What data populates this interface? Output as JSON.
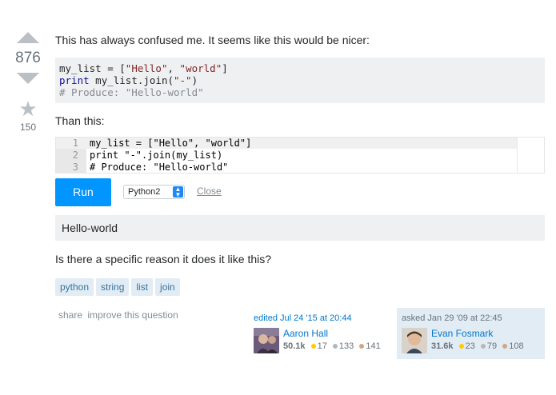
{
  "vote": {
    "score": "876",
    "favorites": "150"
  },
  "post": {
    "intro": "This has always confused me. It seems like this would be nicer:",
    "code_block": {
      "line1_a": "my_list = [",
      "line1_s1": "\"Hello\"",
      "line1_b": ", ",
      "line1_s2": "\"world\"",
      "line1_c": "]",
      "line2_kw": "print",
      "line2_a": " my_list.join(",
      "line2_s": "\"-\"",
      "line2_b": ")",
      "line3": "# Produce: \"Hello-world\""
    },
    "than": "Than this:",
    "editor_lines": [
      {
        "num": "1",
        "code": "my_list = [\"Hello\", \"world\"]"
      },
      {
        "num": "2",
        "code": "print \"-\".join(my_list)"
      },
      {
        "num": "3",
        "code": "# Produce: \"Hello-world\""
      }
    ],
    "run_label": "Run",
    "language": "Python2",
    "close_label": "Close",
    "result": "Hello-world",
    "question": "Is there a specific reason it does it like this?",
    "tags": [
      "python",
      "string",
      "list",
      "join"
    ]
  },
  "actions": {
    "share": "share",
    "improve": "improve this question"
  },
  "edited": {
    "when": "edited Jul 24 '15 at 20:44",
    "user": "Aaron Hall",
    "rep": "50.1k",
    "gold": "17",
    "silver": "133",
    "bronze": "141"
  },
  "asked": {
    "when": "asked Jan 29 '09 at 22:45",
    "user": "Evan Fosmark",
    "rep": "31.6k",
    "gold": "23",
    "silver": "79",
    "bronze": "108"
  },
  "colors": {
    "accent": "#0095ff",
    "link": "#0077cc",
    "tag_bg": "#e1ecf4",
    "tag_fg": "#39739d"
  }
}
